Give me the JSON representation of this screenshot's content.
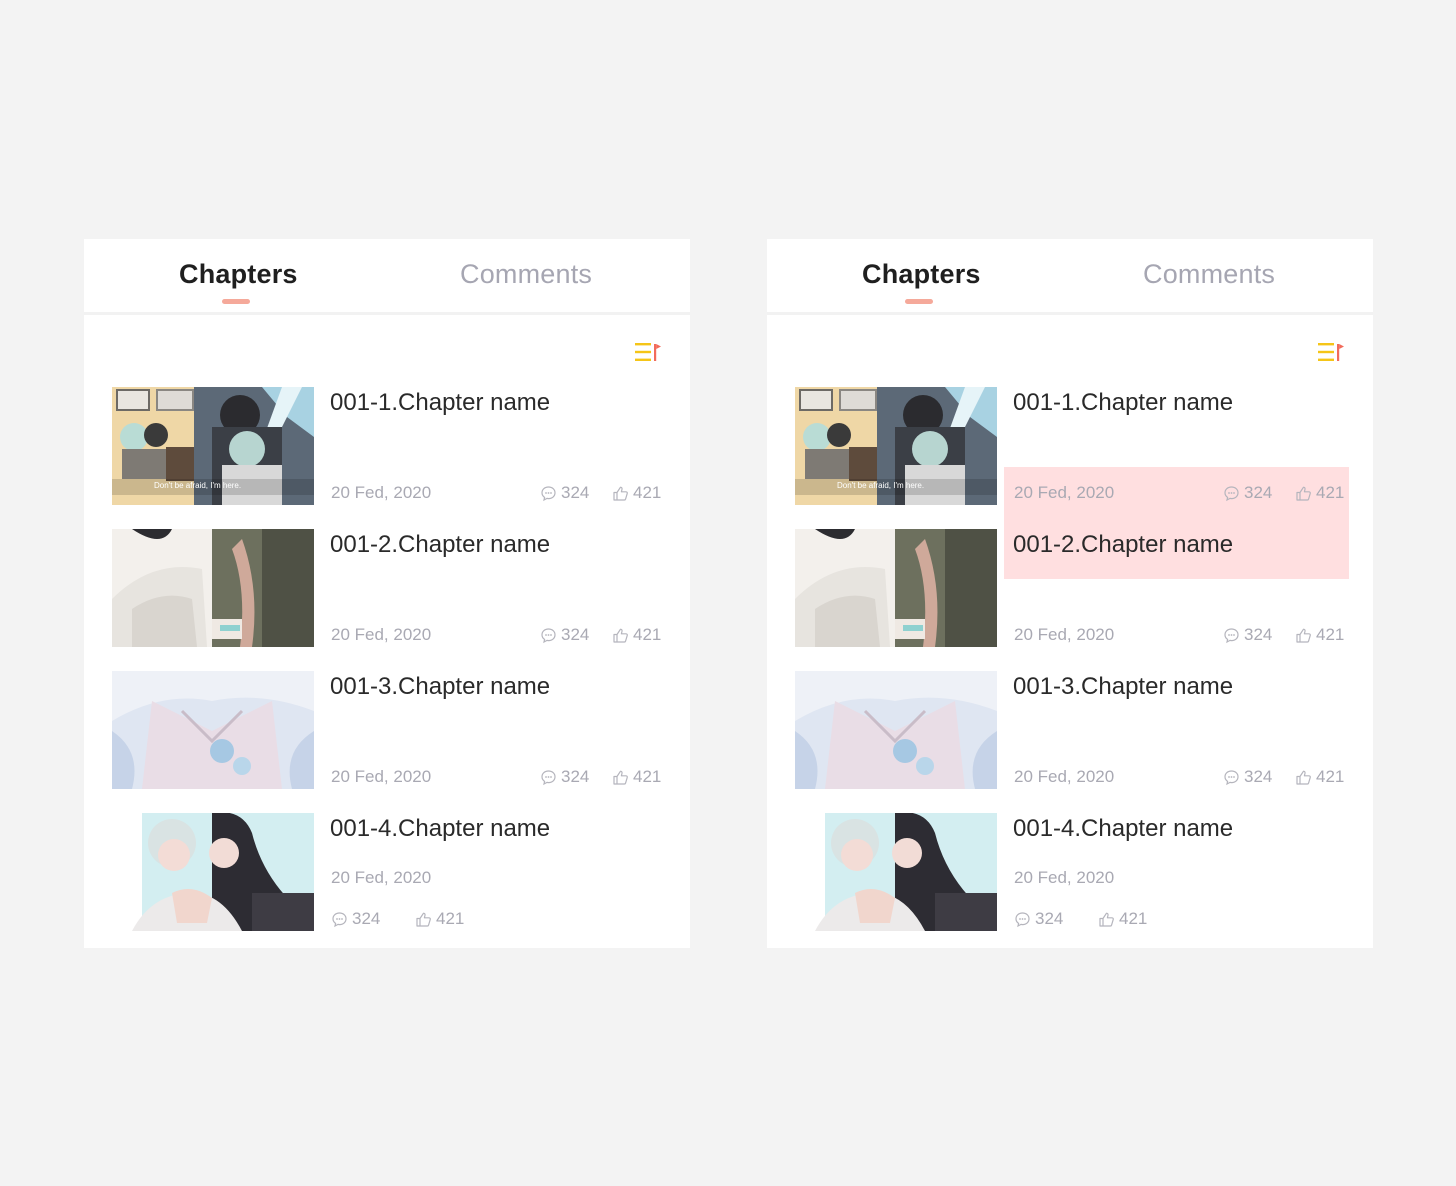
{
  "tabs": {
    "chapters": "Chapters",
    "comments": "Comments"
  },
  "colors": {
    "background": "#f3f3f3",
    "accent_underline": "#f5a99a",
    "sort_icon_lines": "#f5c518",
    "sort_icon_flag": "#f26b5b",
    "highlight": "#ffdfe0"
  },
  "chapters": [
    {
      "title": "001-1.Chapter name",
      "date": "20 Fed, 2020",
      "comments": "324",
      "likes": "421",
      "thumb_caption": "Don't be afraid, I'm here."
    },
    {
      "title": "001-2.Chapter name",
      "date": "20 Fed, 2020",
      "comments": "324",
      "likes": "421"
    },
    {
      "title": "001-3.Chapter name",
      "date": "20 Fed, 2020",
      "comments": "324",
      "likes": "421"
    },
    {
      "title": "001-4.Chapter name",
      "date": "20 Fed, 2020",
      "comments": "324",
      "likes": "421"
    }
  ],
  "icons": {
    "sort": "sort-list-icon",
    "comment": "comment-bubble-icon",
    "like": "thumbs-up-icon"
  }
}
